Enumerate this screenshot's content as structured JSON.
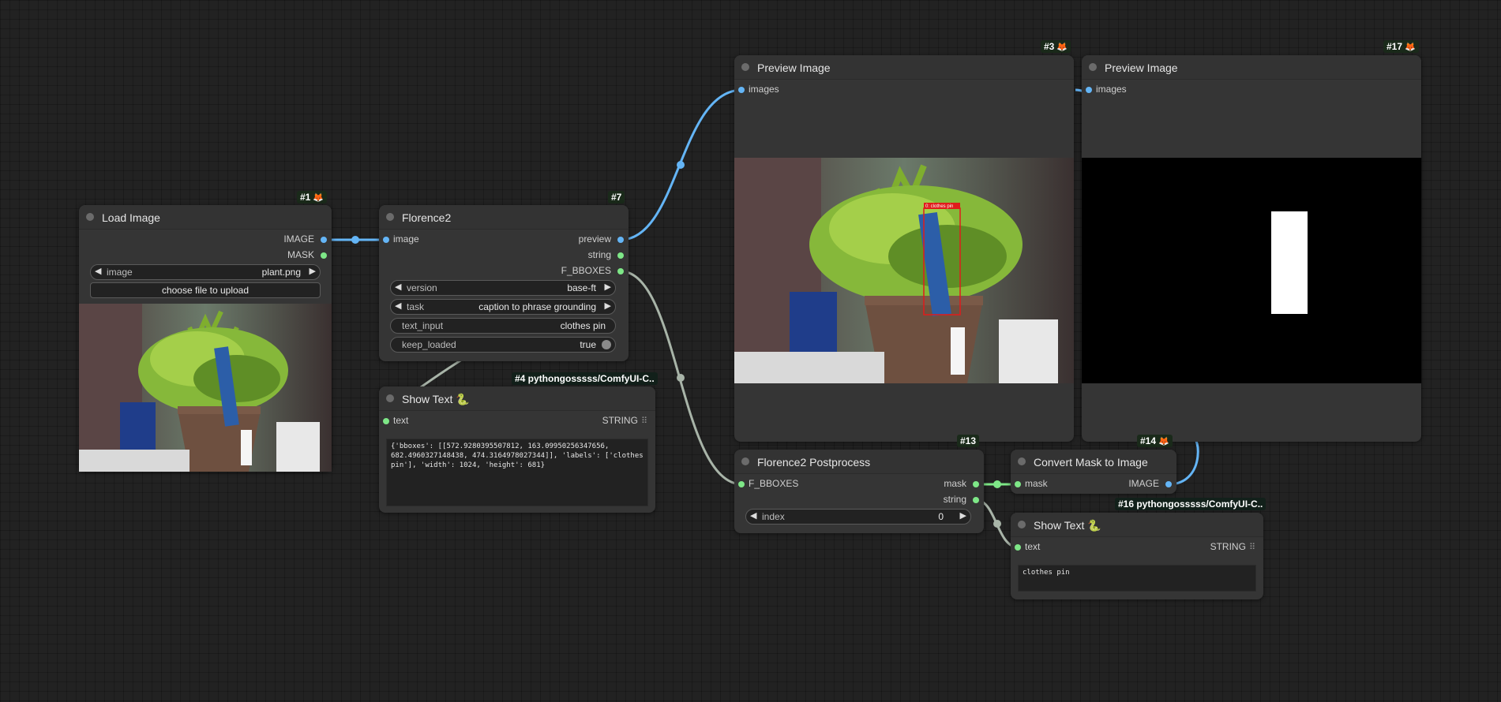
{
  "nodes": {
    "load_image": {
      "id": "#1",
      "title": "Load Image",
      "outputs": [
        "IMAGE",
        "MASK"
      ],
      "image_widget": {
        "label": "image",
        "value": "plant.png"
      },
      "upload_button": "choose file to upload"
    },
    "florence2": {
      "id": "#7",
      "title": "Florence2",
      "input": "image",
      "outputs": [
        "preview",
        "string",
        "F_BBOXES"
      ],
      "widgets": {
        "version": {
          "label": "version",
          "value": "base-ft"
        },
        "task": {
          "label": "task",
          "value": "caption to phrase grounding"
        },
        "text_input": {
          "label": "text_input",
          "value": "clothes pin"
        },
        "keep_loaded": {
          "label": "keep_loaded",
          "value": "true"
        }
      }
    },
    "show_text_4": {
      "id": "#4 pythongosssss/ComfyUI-C..",
      "title": "Show Text",
      "input": "text",
      "output": "STRING",
      "text": "{'bboxes': [[572.9280395507812, 163.09950256347656, 682.4960327148438, 474.3164978027344]], 'labels': ['clothes pin'], 'width': 1024, 'height': 681}"
    },
    "preview_3": {
      "id": "#3",
      "title": "Preview Image",
      "input": "images",
      "bbox_label": "0: clothes pin"
    },
    "preview_17": {
      "id": "#17",
      "title": "Preview Image",
      "input": "images"
    },
    "postprocess": {
      "id": "#13",
      "title": "Florence2 Postprocess",
      "input": "F_BBOXES",
      "outputs": [
        "mask",
        "string"
      ],
      "index_widget": {
        "label": "index",
        "value": "0"
      }
    },
    "convert_mask": {
      "id": "#14",
      "title": "Convert Mask to Image",
      "input": "mask",
      "output": "IMAGE"
    },
    "show_text_16": {
      "id": "#16 pythongosssss/ComfyUI-C..",
      "title": "Show Text",
      "input": "text",
      "output": "STRING",
      "text": "clothes pin"
    }
  },
  "icons": {
    "badge": "fox-icon",
    "python": "snake-icon",
    "menu": "grid-icon"
  },
  "colors": {
    "image_link": "#64b5f6",
    "mask_link": "#7ee787",
    "string_link": "#a8b4a8"
  }
}
